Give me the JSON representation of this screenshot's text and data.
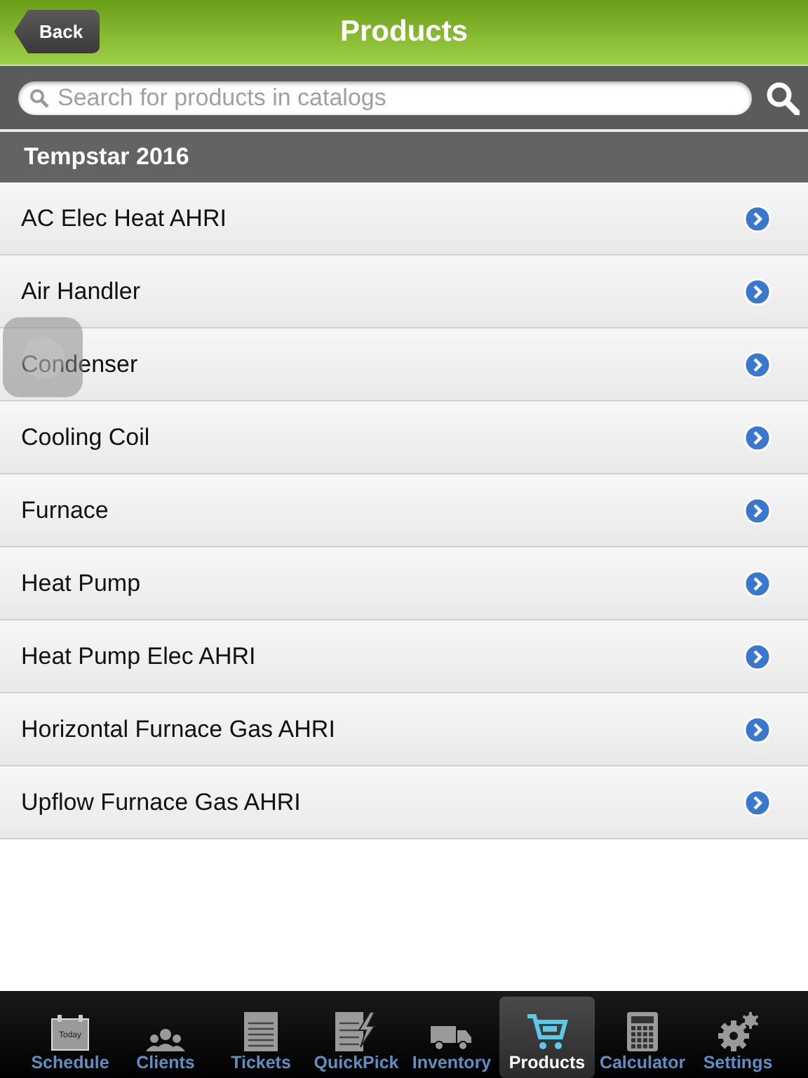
{
  "nav_bar": {
    "back_button": "Back",
    "title": "Products"
  },
  "search": {
    "placeholder": "Search for products in catalogs"
  },
  "section": {
    "title": "Tempstar 2016"
  },
  "items": [
    {
      "label": "AC Elec Heat AHRI"
    },
    {
      "label": "Air Handler"
    },
    {
      "label": "Condenser"
    },
    {
      "label": "Cooling Coil"
    },
    {
      "label": "Furnace"
    },
    {
      "label": "Heat Pump"
    },
    {
      "label": "Heat Pump Elec AHRI"
    },
    {
      "label": "Horizontal Furnace Gas AHRI"
    },
    {
      "label": "Upflow Furnace Gas AHRI"
    }
  ],
  "tab_bar": [
    {
      "label": "Schedule",
      "kind": "calendar",
      "icon_text": "Today",
      "selected": false
    },
    {
      "label": "Clients",
      "kind": "people",
      "selected": false
    },
    {
      "label": "Tickets",
      "kind": "document",
      "selected": false
    },
    {
      "label": "QuickPick",
      "kind": "bolt",
      "selected": false
    },
    {
      "label": "Inventory",
      "kind": "truck",
      "selected": false
    },
    {
      "label": "Products",
      "kind": "cart",
      "selected": true
    },
    {
      "label": "Calculator",
      "kind": "calculator",
      "selected": false
    },
    {
      "label": "Settings",
      "kind": "gears",
      "selected": false
    }
  ]
}
